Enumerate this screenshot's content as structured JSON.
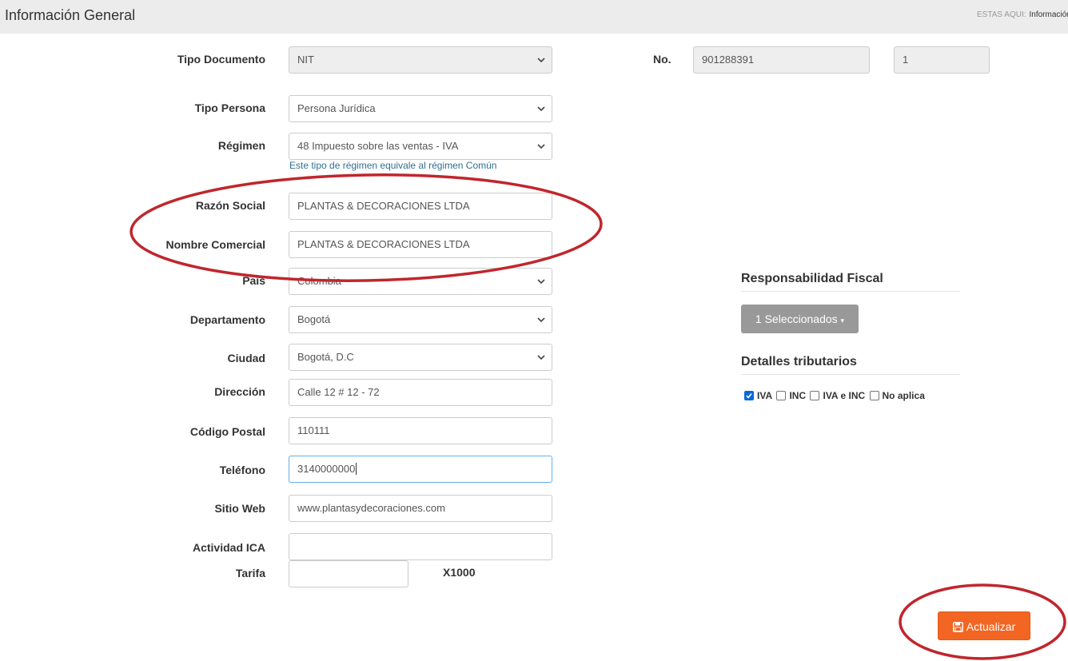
{
  "header": {
    "title": "Información General",
    "breadcrumb_label": "ESTAS AQUI:",
    "breadcrumb_current": "Información General"
  },
  "form": {
    "tipo_documento": {
      "label": "Tipo Documento",
      "value": "NIT"
    },
    "numero": {
      "label": "No.",
      "value": "901288391",
      "dv": "1"
    },
    "tipo_persona": {
      "label": "Tipo Persona",
      "value": "Persona Jurídica"
    },
    "regimen": {
      "label": "Régimen",
      "value": "48 Impuesto sobre las ventas - IVA",
      "help": "Este tipo de régimen equivale al régimen Común"
    },
    "razon_social": {
      "label": "Razón Social",
      "value": "PLANTAS & DECORACIONES LTDA"
    },
    "nombre_comercial": {
      "label": "Nombre Comercial",
      "value": "PLANTAS & DECORACIONES LTDA"
    },
    "pais": {
      "label": "País",
      "value": "Colombia"
    },
    "departamento": {
      "label": "Departamento",
      "value": "Bogotá"
    },
    "ciudad": {
      "label": "Ciudad",
      "value": "Bogotá, D.C"
    },
    "direccion": {
      "label": "Dirección",
      "value": "Calle 12 # 12 - 72"
    },
    "codigo_postal": {
      "label": "Código Postal",
      "value": "110111"
    },
    "telefono": {
      "label": "Teléfono",
      "value": "3140000000"
    },
    "sitio_web": {
      "label": "Sitio Web",
      "value": "www.plantasydecoraciones.com"
    },
    "actividad_ica": {
      "label": "Actividad ICA",
      "value": ""
    },
    "tarifa": {
      "label": "Tarifa",
      "value": "",
      "suffix": "X1000"
    }
  },
  "fiscal": {
    "title": "Responsabilidad Fiscal",
    "button_label": "1 Seleccionados"
  },
  "tributarios": {
    "title": "Detalles tributarios",
    "options": [
      {
        "label": "IVA",
        "checked": true
      },
      {
        "label": "INC",
        "checked": false
      },
      {
        "label": "IVA e INC",
        "checked": false
      },
      {
        "label": "No aplica",
        "checked": false
      }
    ]
  },
  "actions": {
    "update_label": "Actualizar"
  },
  "colors": {
    "accent": "#f26522",
    "annotation": "#c0262d",
    "multiselect": "#999999",
    "help_text": "#31708f"
  },
  "icons": {
    "caret": "chevron-down-icon",
    "save": "floppy-disk-icon"
  }
}
